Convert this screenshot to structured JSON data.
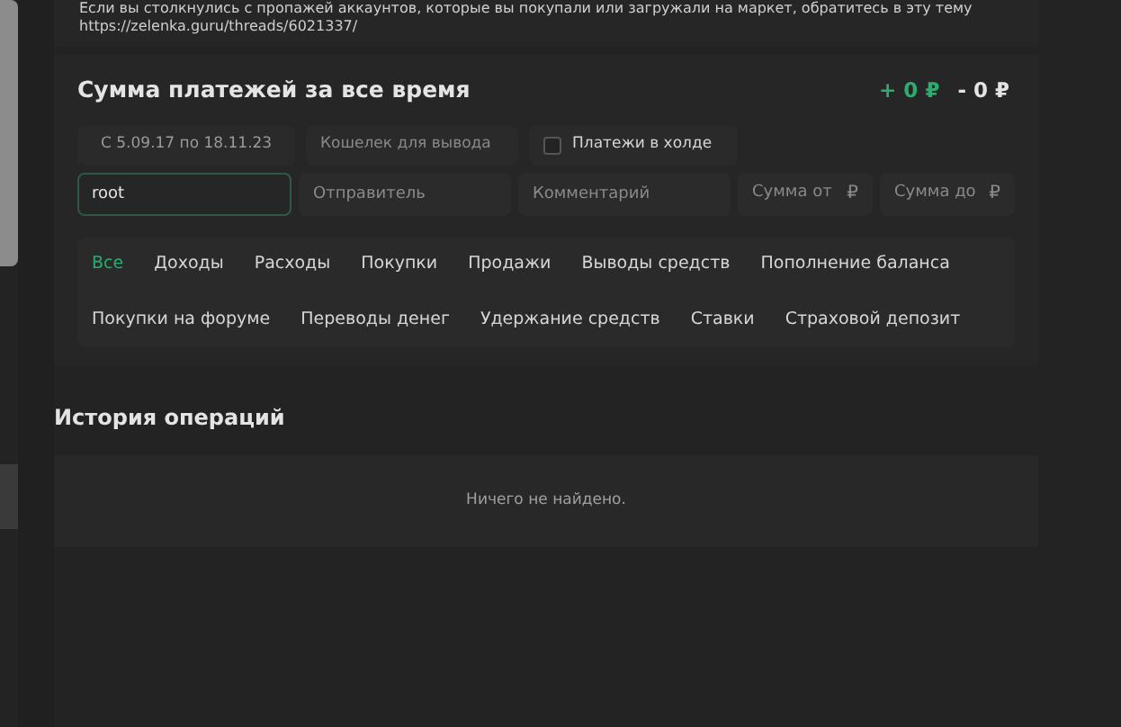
{
  "notice": {
    "text": "Если вы столкнулись с пропажей аккаунтов, которые вы покупали или загружали на маркет, обратитесь в эту тему",
    "link": "https://zelenka.guru/threads/6021337/"
  },
  "summary": {
    "title": "Сумма платежей за все время",
    "income": "+ 0 ₽",
    "expense": "- 0 ₽"
  },
  "filters": {
    "date_range": "С 5.09.17 по 18.11.23",
    "wallet": {
      "placeholder": "Кошелек для вывода"
    },
    "hold": {
      "label": "Платежи в холде",
      "checked": false
    },
    "search": {
      "value": "root"
    },
    "sender": {
      "placeholder": "Отправитель"
    },
    "comment": {
      "placeholder": "Комментарий"
    },
    "amount_from": {
      "placeholder": "Сумма от",
      "currency": "₽"
    },
    "amount_to": {
      "placeholder": "Сумма до",
      "currency": "₽"
    }
  },
  "tabs": [
    {
      "label": "Все",
      "selected": true
    },
    {
      "label": "Доходы",
      "selected": false
    },
    {
      "label": "Расходы",
      "selected": false
    },
    {
      "label": "Покупки",
      "selected": false
    },
    {
      "label": "Продажи",
      "selected": false
    },
    {
      "label": "Выводы средств",
      "selected": false
    },
    {
      "label": "Пополнение баланса",
      "selected": false
    },
    {
      "label": "Покупки на форуме",
      "selected": false
    },
    {
      "label": "Переводы денег",
      "selected": false
    },
    {
      "label": "Удержание средств",
      "selected": false
    },
    {
      "label": "Ставки",
      "selected": false
    },
    {
      "label": "Страховой депозит",
      "selected": false
    }
  ],
  "history": {
    "title": "История операций",
    "empty": "Ничего не найдено."
  }
}
